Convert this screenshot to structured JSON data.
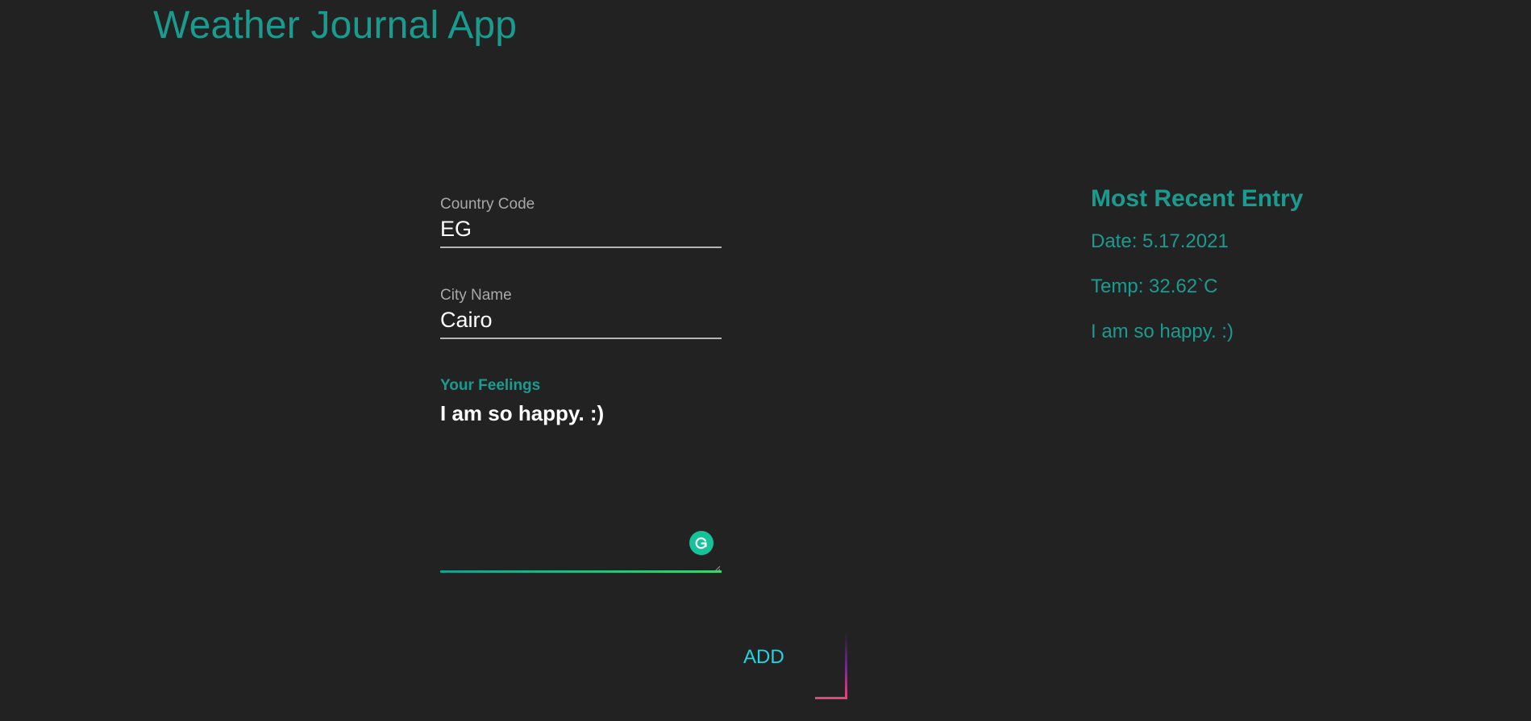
{
  "app": {
    "title": "Weather Journal App"
  },
  "form": {
    "country": {
      "label": "Country Code",
      "value": "EG"
    },
    "city": {
      "label": "City Name",
      "value": "Cairo"
    },
    "feelings": {
      "label": "Your Feelings",
      "value": "I am so happy. :)"
    },
    "submit_label": "ADD"
  },
  "recent_entry": {
    "title": "Most Recent Entry",
    "date": "Date: 5.17.2021",
    "temp": "Temp: 32.62`C",
    "content": "I am so happy. :)"
  },
  "icons": {
    "grammarly": "grammarly-icon",
    "resize": "resize-handle-icon"
  },
  "colors": {
    "background": "#222222",
    "accent": "#1a9b8f",
    "button_text": "#1ed7e0",
    "button_corner": "#e8457a",
    "grammarly": "#15c39a"
  }
}
